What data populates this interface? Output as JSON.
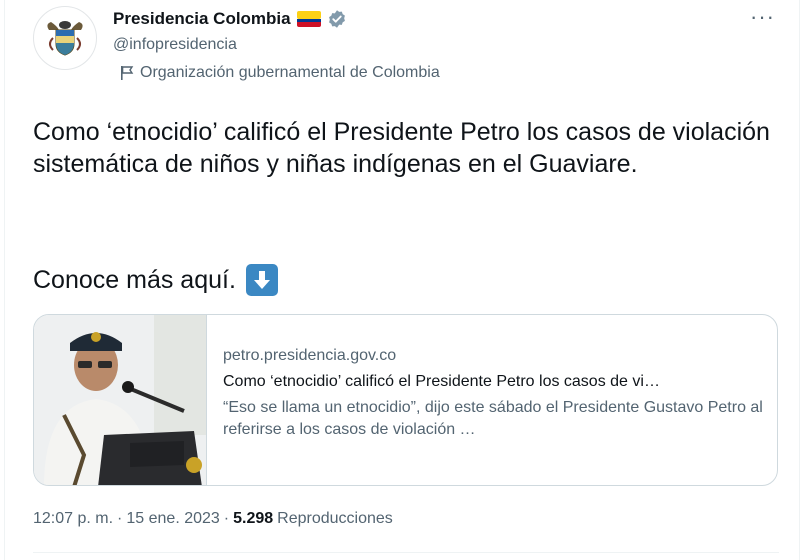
{
  "account": {
    "display_name": "Presidencia Colombia",
    "handle": "@infopresidencia",
    "affiliation": "Organización gubernamental de Colombia"
  },
  "tweet": {
    "text": "Como ‘etnocidio’ calificó el Presidente Petro los casos de violación sistemática de niños y niñas indígenas en el Guaviare.",
    "cta": "Conoce más aquí."
  },
  "link_card": {
    "domain": "petro.presidencia.gov.co",
    "title": "Como ‘etnocidio’ calificó el Presidente Petro los casos de vi…",
    "description": "“Eso se llama un etnocidio”, dijo este sábado el Presidente Gustavo Petro al referirse a los casos de violación …"
  },
  "meta": {
    "time": "12:07 p. m.",
    "sep1": "·",
    "date": "15 ene. 2023",
    "sep2": "·",
    "views": "5.298",
    "views_label": "Reproducciones"
  },
  "colors": {
    "text": "#0f1419",
    "secondary": "#536471",
    "verified_gray": "#829aab",
    "emoji_blue": "#3b88c3"
  }
}
